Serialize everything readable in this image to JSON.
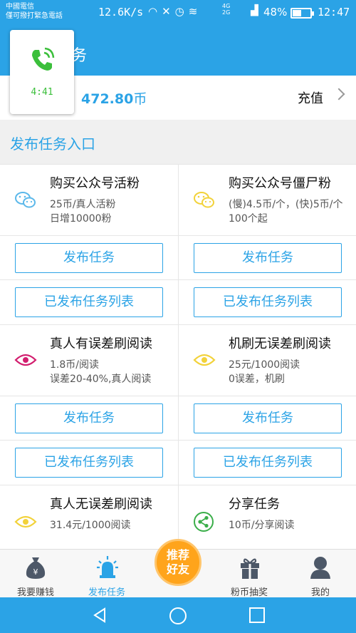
{
  "status_bar": {
    "carrier_line1": "中國電信",
    "carrier_line2": "僅可撥打緊急電話",
    "net_speed": "12.6K/s",
    "network_type_top": "4G",
    "network_type_bottom": "2G",
    "battery_percent": "48%",
    "battery_level": 0.48,
    "time": "12:47"
  },
  "header": {
    "title_fragment": "务"
  },
  "call_overlay": {
    "icon": "phone-call-icon",
    "duration": "4:41"
  },
  "balance": {
    "amount": "472.80",
    "unit": "币",
    "recharge_label": "充值"
  },
  "section_title": "发布任务入口",
  "tasks": [
    {
      "title": "购买公众号活粉",
      "desc": [
        "25币/真人活粉",
        "日增10000粉"
      ],
      "icon": "wechat-icon",
      "icon_color": "#5bb8ea"
    },
    {
      "title": "购买公众号僵尸粉",
      "desc": [
        "(慢)4.5币/个，(快)5币/个",
        "100个起"
      ],
      "icon": "wechat-icon",
      "icon_color": "#f2d23a"
    },
    {
      "title": "真人有误差刷阅读",
      "desc": [
        "1.8币/阅读",
        "误差20-40%,真人阅读"
      ],
      "icon": "eye-icon",
      "icon_color": "#d21d6e"
    },
    {
      "title": "机刷无误差刷阅读",
      "desc": [
        "25元/1000阅读",
        "0误差，机刷"
      ],
      "icon": "eye-icon",
      "icon_color": "#f2d23a"
    },
    {
      "title": "真人无误差刷阅读",
      "desc": [
        "31.4元/1000阅读"
      ],
      "icon": "eye-icon",
      "icon_color": "#f2d23a"
    },
    {
      "title": "分享任务",
      "desc": [
        "10币/分享阅读"
      ],
      "icon": "share-icon",
      "icon_color": "#3bae4a"
    }
  ],
  "buttons": {
    "publish": "发布任务",
    "published_list": "已发布任务列表"
  },
  "bottom_nav": {
    "items": [
      {
        "label": "我要赚钱",
        "icon": "money-bag-icon"
      },
      {
        "label": "发布任务",
        "icon": "alarm-light-icon",
        "active": true
      },
      {
        "label": "粉币抽奖",
        "icon": "gift-icon"
      },
      {
        "label": "我的",
        "icon": "user-icon"
      }
    ],
    "recommend_line1": "推荐",
    "recommend_line2": "好友"
  },
  "colors": {
    "primary": "#2ba3e6",
    "accent": "#ffa41b"
  }
}
